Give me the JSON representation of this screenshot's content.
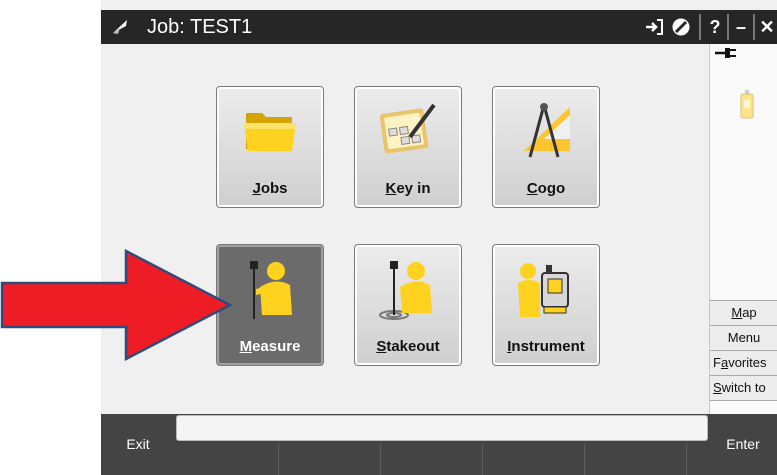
{
  "title_bar": {
    "title": "Job: TEST1",
    "help_label": "?",
    "minimize_label": "–",
    "close_label": "✕"
  },
  "tiles": [
    {
      "label": "Jobs",
      "underline": "J",
      "rest": "obs"
    },
    {
      "label": "Key in",
      "underline": "K",
      "rest": "ey in"
    },
    {
      "label": "Cogo",
      "underline": "C",
      "rest": "ogo"
    },
    {
      "label": "Measure",
      "underline": "M",
      "rest": "easure"
    },
    {
      "label": "Stakeout",
      "underline": "S",
      "rest": "takeout"
    },
    {
      "label": "Instrument",
      "underline": "I",
      "rest": "nstrument"
    }
  ],
  "side_panel": {
    "buttons": [
      {
        "underline": "M",
        "rest": "ap"
      },
      {
        "underline": "",
        "rest": "Menu"
      },
      {
        "pre": "F",
        "underline": "a",
        "rest": "vorites"
      },
      {
        "pre": "",
        "underline": "S",
        "rest": "witch to"
      }
    ]
  },
  "bottom_bar": {
    "exit_label": "Exit",
    "enter_label": "Enter"
  },
  "colors": {
    "title_bar": "#262626",
    "bottom_bar": "#444444",
    "arrow_fill": "#ee1c24",
    "arrow_stroke": "#2f4b7c",
    "selected_tile": "#6b6b6b"
  }
}
